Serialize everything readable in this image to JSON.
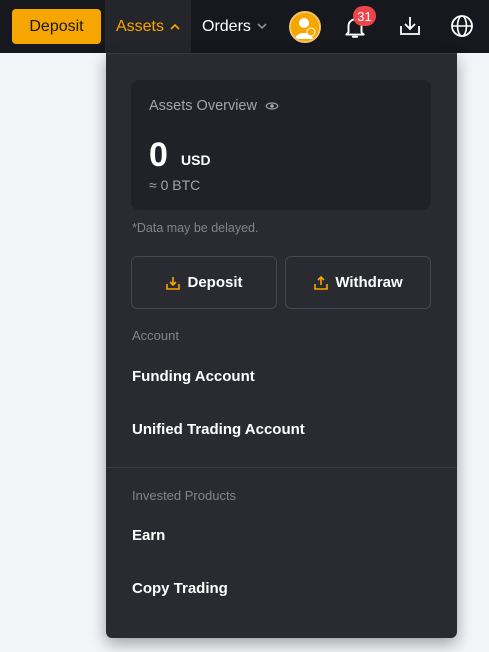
{
  "topbar": {
    "deposit_label": "Deposit",
    "assets_label": "Assets",
    "orders_label": "Orders",
    "notification_count": "31"
  },
  "dropdown": {
    "overview": {
      "title": "Assets Overview",
      "amount": "0",
      "currency": "USD",
      "btc_equivalent": "≈ 0 BTC"
    },
    "delayed_note": "*Data may be delayed.",
    "deposit_label": "Deposit",
    "withdraw_label": "Withdraw",
    "account_section": {
      "label": "Account",
      "items": [
        "Funding Account",
        "Unified Trading Account"
      ]
    },
    "invested_section": {
      "label": "Invested Products",
      "items": [
        "Earn",
        "Copy Trading"
      ]
    }
  },
  "colors": {
    "accent": "#f7a600",
    "topbar_bg": "#17181e",
    "dropdown_bg": "#2a2b31",
    "badge": "#ef454a"
  }
}
